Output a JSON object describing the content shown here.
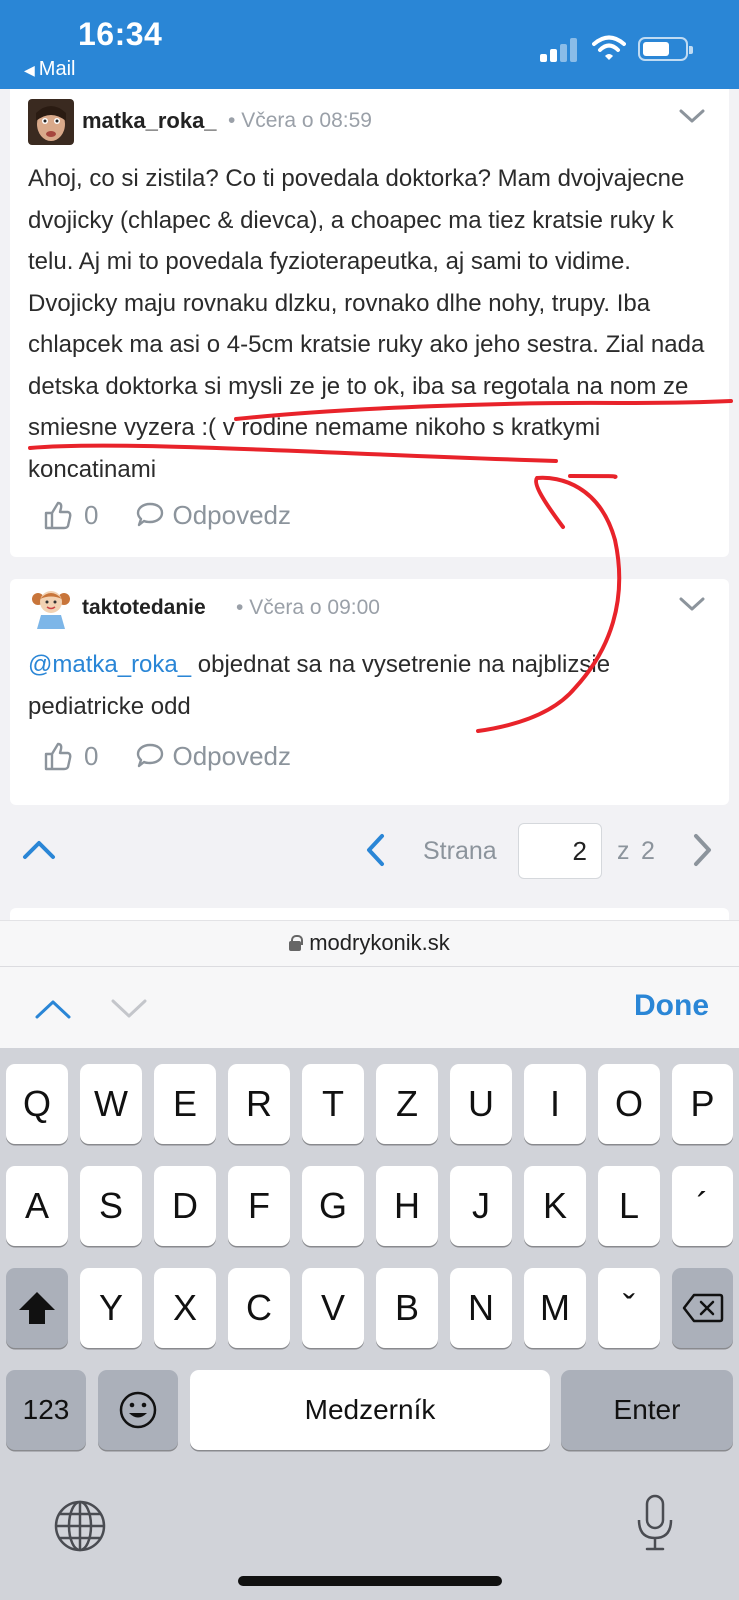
{
  "status_bar": {
    "time": "16:34",
    "back_label": "Mail"
  },
  "comments": [
    {
      "username": "matka_roka_",
      "timestamp": "Včera o 08:59",
      "text": "Ahoj, co si zistila? Co ti povedala doktorka? Mam dvojvajecne dvojicky (chlapec & dievca), a choapec ma tiez kratsie ruky k telu. Aj mi to povedala fyzioterapeutka, aj sami to vidime. Dvojicky maju rovnaku dlzku, rovnako dlhe nohy, trupy. Iba chlapcek ma asi o 4-5cm kratsie ruky ako jeho sestra. Zial nada detska doktorka si mysli ze je to ok, iba sa regotala na nom ze smiesne vyzera :( v rodine nemame nikoho s kratkymi koncatinami",
      "likes": "0",
      "reply_label": "Odpovedz"
    },
    {
      "username": "taktotedanie",
      "timestamp": "Včera o 09:00",
      "mention": "@matka_roka_",
      "text": " objednat sa na vysetrenie na najblizsie pediatricke odd",
      "likes": "0",
      "reply_label": "Odpovedz"
    }
  ],
  "pagination": {
    "label": "Strana",
    "current": "2",
    "of_label": "z",
    "total": "2"
  },
  "url_bar": {
    "domain": "modrykonik.sk"
  },
  "accessory": {
    "done_label": "Done"
  },
  "keyboard": {
    "row1": [
      "Q",
      "W",
      "E",
      "R",
      "T",
      "Z",
      "U",
      "I",
      "O",
      "P"
    ],
    "row2": [
      "A",
      "S",
      "D",
      "F",
      "G",
      "H",
      "J",
      "K",
      "L",
      "´"
    ],
    "row3": [
      "Y",
      "X",
      "C",
      "V",
      "B",
      "N",
      "M",
      "ˇ"
    ],
    "numbers_label": "123",
    "space_label": "Medzerník",
    "enter_label": "Enter"
  },
  "colors": {
    "accent": "#2a86d6",
    "annotation": "#e8232a"
  }
}
